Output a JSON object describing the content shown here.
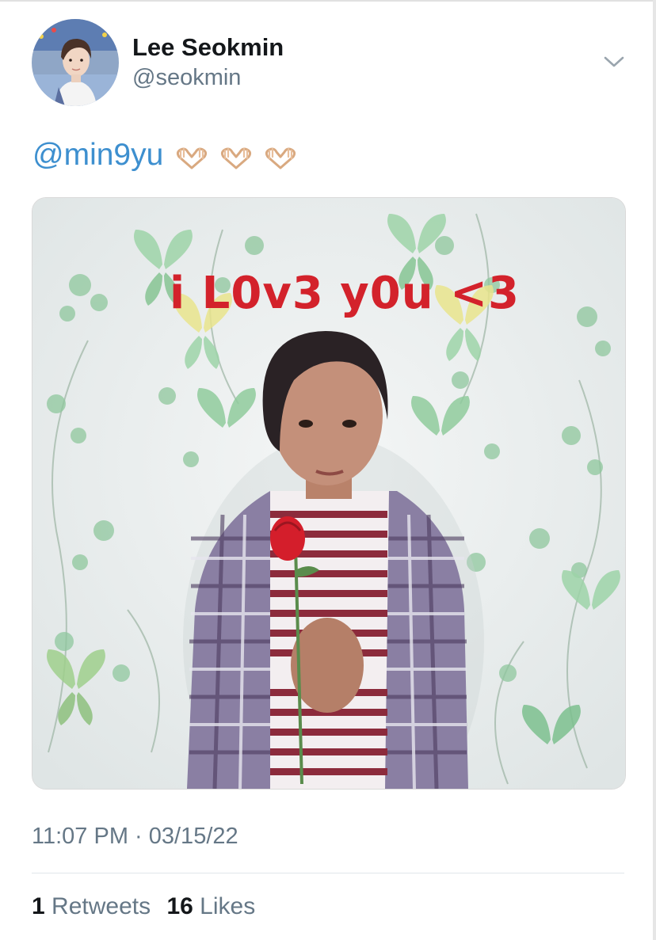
{
  "author": {
    "display_name": "Lee Seokmin",
    "handle": "@seokmin"
  },
  "tweet": {
    "mention": "@min9yu",
    "emoji": [
      "heart-hands",
      "heart-hands",
      "heart-hands"
    ],
    "image_caption": "i L0v3 y0u <3",
    "timestamp": "11:07 PM · 03/15/22"
  },
  "stats": {
    "retweets_count": "1",
    "retweets_label": "Retweets",
    "likes_count": "16",
    "likes_label": "Likes"
  },
  "colors": {
    "link": "#3d8fcf",
    "secondary_text": "#657786",
    "caption_red": "#d3222b"
  }
}
